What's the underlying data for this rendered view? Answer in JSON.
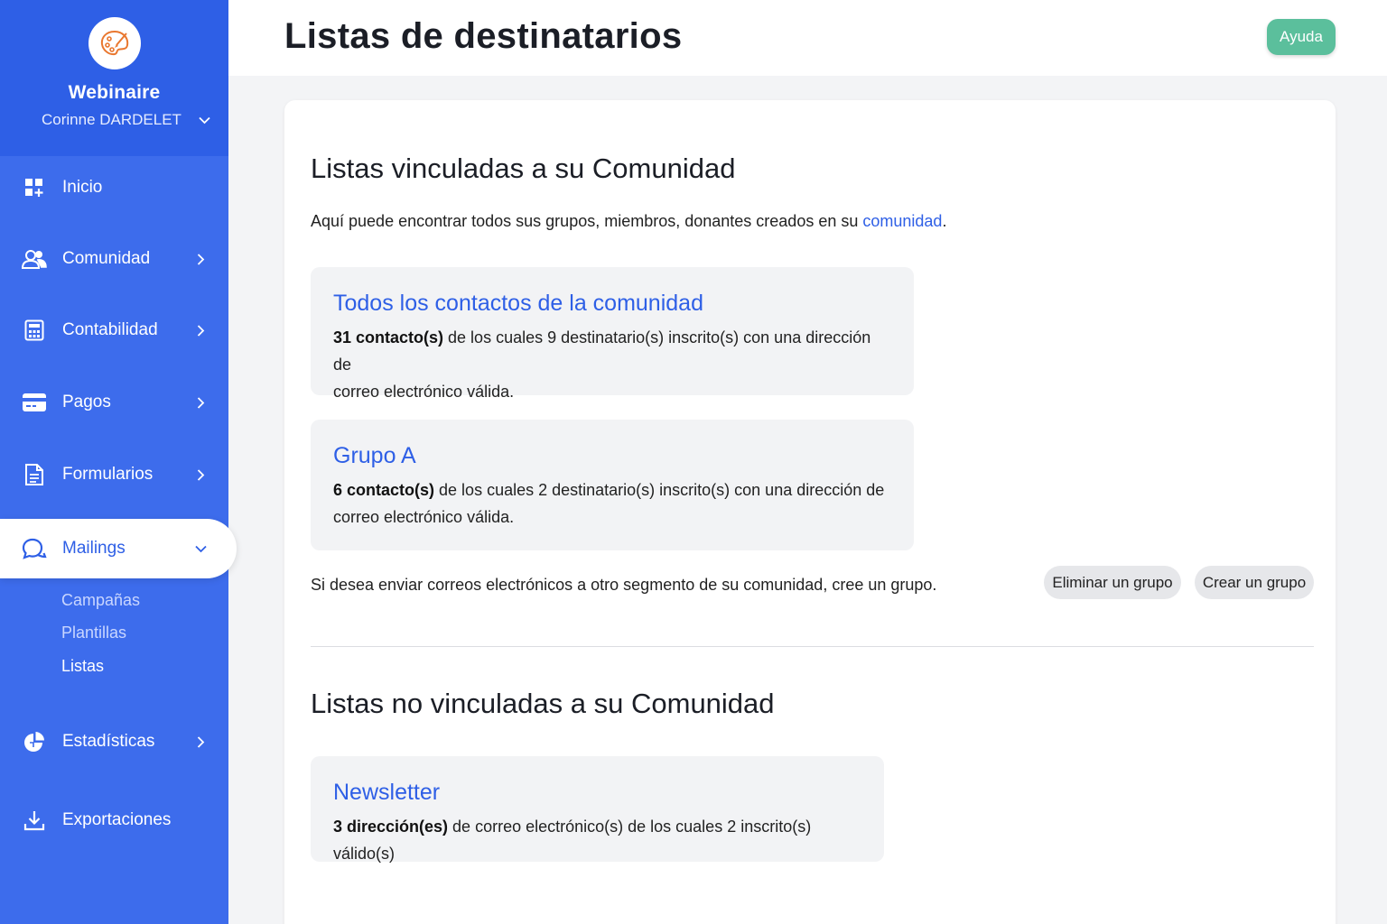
{
  "sidebar": {
    "org_name": "Webinaire",
    "user_name": "Corinne DARDELET",
    "items": [
      {
        "label": "Inicio",
        "icon": "dashboard-icon"
      },
      {
        "label": "Comunidad",
        "icon": "users-icon"
      },
      {
        "label": "Contabilidad",
        "icon": "calculator-icon"
      },
      {
        "label": "Pagos",
        "icon": "credit-card-icon"
      },
      {
        "label": "Formularios",
        "icon": "document-icon"
      },
      {
        "label": "Mailings",
        "icon": "chat-icon"
      },
      {
        "label": "Estadísticas",
        "icon": "pie-chart-icon"
      },
      {
        "label": "Exportaciones",
        "icon": "download-icon"
      }
    ],
    "mailings_sub": [
      {
        "label": "Campañas"
      },
      {
        "label": "Plantillas"
      },
      {
        "label": "Listas"
      }
    ]
  },
  "header": {
    "title": "Listas de destinatarios",
    "help_label": "Ayuda"
  },
  "linked": {
    "title": "Listas vinculadas a su Comunidad",
    "desc_prefix": "Aquí puede encontrar todos sus grupos, miembros, donantes creados en su ",
    "desc_link": "comunidad",
    "desc_suffix": ".",
    "lists": [
      {
        "title": "Todos los contactos de la comunidad",
        "count_bold": "31 contacto(s)",
        "rest_line1": " de los cuales 9 destinatario(s) inscrito(s) con una dirección de",
        "rest_line2": "correo electrónico válida."
      },
      {
        "title": "Grupo A",
        "count_bold": "6 contacto(s)",
        "rest_line1": " de los cuales 2 destinatario(s) inscrito(s) con una dirección de",
        "rest_line2": "correo electrónico válida."
      }
    ],
    "segment_text": "Si desea enviar correos electrónicos a otro segmento de su comunidad, cree un grupo.",
    "delete_group_label": "Eliminar un grupo",
    "create_group_label": "Crear un grupo"
  },
  "unlinked": {
    "title": "Listas no vinculadas a su Comunidad",
    "lists": [
      {
        "title": "Newsletter",
        "count_bold": "3 dirección(es)",
        "rest": " de correo electrónico(s) de los cuales 2 inscrito(s) válido(s)"
      }
    ]
  },
  "colors": {
    "sidebar": "#3d6cec",
    "accent": "#2e5fe6",
    "help": "#5bbf9c"
  }
}
